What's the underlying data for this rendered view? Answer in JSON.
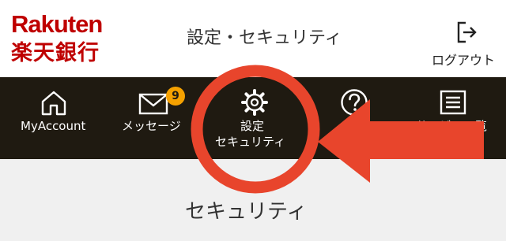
{
  "header": {
    "logo": {
      "line1": "Rakuten",
      "line2": "楽天銀行"
    },
    "page_title": "設定・セキュリティ",
    "logout_label": "ログアウト"
  },
  "nav": {
    "items": [
      {
        "label": "MyAccount",
        "icon": "home-icon"
      },
      {
        "label": "メッセージ",
        "icon": "mail-icon",
        "badge": "9"
      },
      {
        "label_line1": "設定",
        "label_line2": "セキュリティ",
        "icon": "gear-icon",
        "active": true
      },
      {
        "label": "",
        "icon": "help-icon"
      },
      {
        "label": "サービス一覧",
        "icon": "list-icon"
      }
    ]
  },
  "main": {
    "section_title": "セキュリティ"
  },
  "colors": {
    "brand_red": "#bf0000",
    "nav_bg": "#1f1a11",
    "badge_bg": "#f5a100",
    "annotation_red": "#e8452c",
    "content_bg": "#f0f0f0"
  }
}
